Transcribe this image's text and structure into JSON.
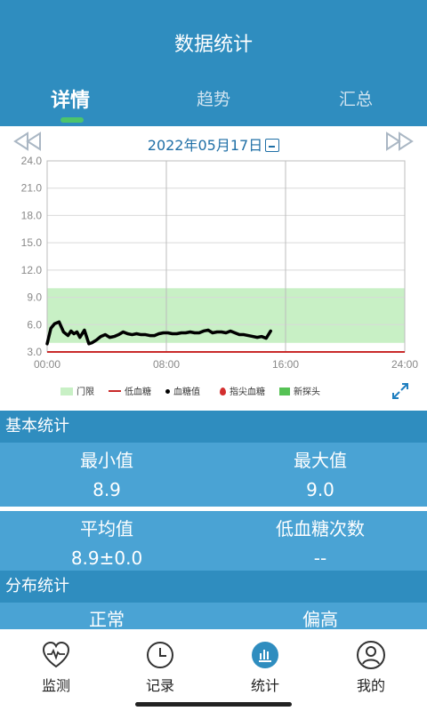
{
  "header": {
    "title": "数据统计",
    "tabs": [
      {
        "label": "详情"
      },
      {
        "label": "趋势"
      },
      {
        "label": "汇总"
      }
    ]
  },
  "date": "2022年05月17日",
  "chart_data": {
    "type": "line",
    "x_ticks": [
      "00:00",
      "08:00",
      "16:00",
      "24:00"
    ],
    "y_ticks": [
      "3.0",
      "6.0",
      "9.0",
      "12.0",
      "15.0",
      "18.0",
      "21.0",
      "24.0"
    ],
    "ylim": [
      3,
      24
    ],
    "xlim": [
      0,
      24
    ],
    "target_range": [
      4.0,
      10.0
    ],
    "low_threshold": 3.0,
    "series": [
      {
        "name": "血糖值",
        "x": [
          0.0,
          0.25,
          0.5,
          0.8,
          1.1,
          1.4,
          1.6,
          1.8,
          2.0,
          2.2,
          2.5,
          2.8,
          3.0,
          3.3,
          3.6,
          3.9,
          4.2,
          4.5,
          4.8,
          5.1,
          5.4,
          5.7,
          6.0,
          6.3,
          6.6,
          6.9,
          7.2,
          7.5,
          7.8,
          8.1,
          8.4,
          8.7,
          9.0,
          9.3,
          9.6,
          9.9,
          10.2,
          10.5,
          10.8,
          11.1,
          11.4,
          11.7,
          12.0,
          12.3,
          12.6,
          12.9,
          13.2,
          13.5,
          13.8,
          14.1,
          14.4,
          14.7,
          15.0
        ],
        "y": [
          3.9,
          5.6,
          6.1,
          6.3,
          5.2,
          4.8,
          5.3,
          5.0,
          5.2,
          4.6,
          5.4,
          3.9,
          4.0,
          4.3,
          4.7,
          4.9,
          4.6,
          4.7,
          4.9,
          5.2,
          5.0,
          4.9,
          5.0,
          4.9,
          4.9,
          4.8,
          4.8,
          5.0,
          5.1,
          5.1,
          5.0,
          5.0,
          5.1,
          5.1,
          5.2,
          5.1,
          5.1,
          5.3,
          5.4,
          5.1,
          5.2,
          5.2,
          5.1,
          5.3,
          5.1,
          4.9,
          4.9,
          4.8,
          4.7,
          4.6,
          4.7,
          4.5,
          5.3
        ]
      }
    ]
  },
  "legend": [
    "门限",
    "低血糖",
    "血糖值",
    "指尖血糖",
    "新探头"
  ],
  "colors": {
    "header": "#2f8dbf",
    "stat_row": "#4aa3d4",
    "target": "#c8f0c5",
    "low": "#c92a2a",
    "new_probe": "#56c255",
    "fingertip": "#d32f2f"
  },
  "basic_stats": {
    "title": "基本统计",
    "min_label": "最小值",
    "min_value": "8.9",
    "max_label": "最大值",
    "max_value": "9.0",
    "avg_label": "平均值",
    "avg_value": "8.9±0.0",
    "low_label": "低血糖次数",
    "low_value": "--"
  },
  "distribution": {
    "title": "分布统计",
    "normal_label": "正常",
    "high_label": "偏高"
  },
  "nav": [
    {
      "label": "监测",
      "icon": "heart-monitor-icon"
    },
    {
      "label": "记录",
      "icon": "clock-icon"
    },
    {
      "label": "统计",
      "icon": "bar-chart-icon"
    },
    {
      "label": "我的",
      "icon": "user-icon"
    }
  ]
}
